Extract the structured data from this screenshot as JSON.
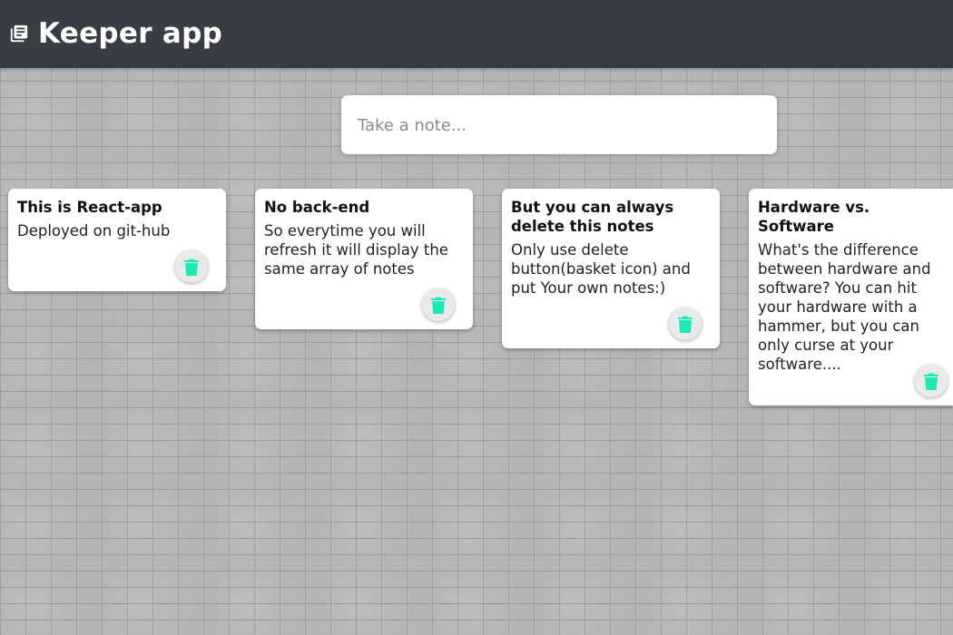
{
  "header": {
    "title": "Keeper app",
    "icon": "notes-stack-icon"
  },
  "composer": {
    "placeholder": "Take a note...",
    "value": ""
  },
  "colors": {
    "header_bg": "#383c43",
    "delete_icon": "#1de9b6",
    "note_bg": "#ffffff"
  },
  "notes": [
    {
      "title": "This is React-app",
      "content": "Deployed on git-hub",
      "delete_icon": "trash-icon"
    },
    {
      "title": "No back-end",
      "content": "So everytime you will refresh it will display the same array of notes",
      "delete_icon": "trash-icon"
    },
    {
      "title": "But you can always delete this notes",
      "content": "Only use delete button(basket icon) and put Your own notes:)",
      "delete_icon": "trash-icon"
    },
    {
      "title": "Hardware vs. Software",
      "content": "What's the difference between hardware and software? You can hit your hardware with a hammer, but you can only curse at your software....",
      "delete_icon": "trash-icon"
    }
  ]
}
